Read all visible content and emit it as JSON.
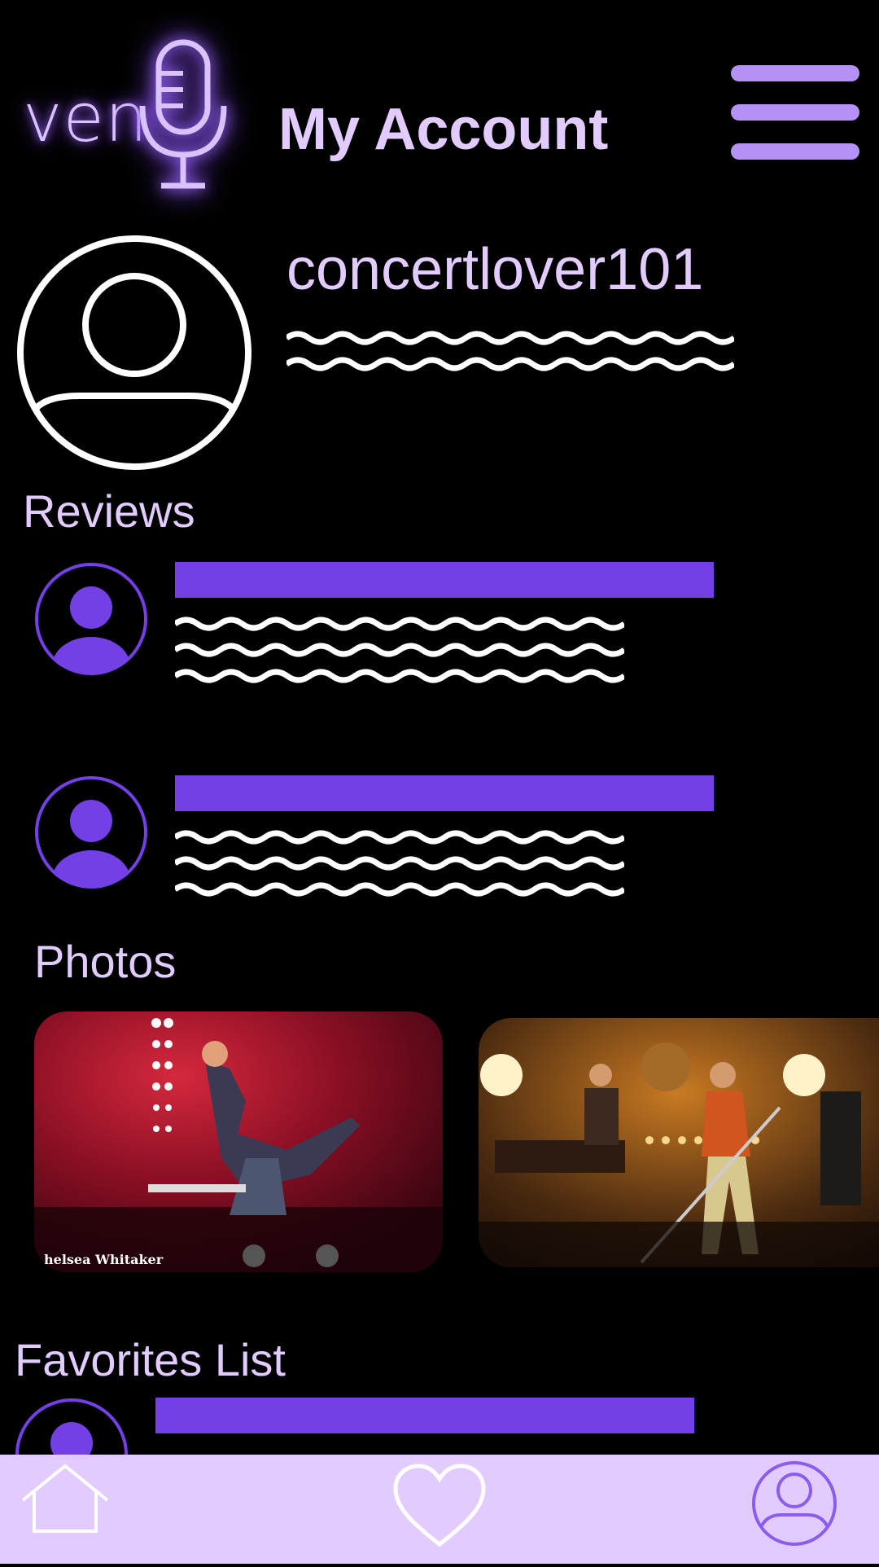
{
  "header": {
    "logo_text": "ven",
    "title": "My Account",
    "menu_icon": "hamburger-menu-icon"
  },
  "profile": {
    "username": "concertlover101",
    "avatar_icon": "user-avatar-icon"
  },
  "reviews": {
    "label": "Reviews",
    "items": [
      {
        "avatar_icon": "user-avatar-icon"
      },
      {
        "avatar_icon": "user-avatar-icon"
      }
    ]
  },
  "photos": {
    "label": "Photos",
    "items": [
      {
        "credit": "helsea Whitaker"
      },
      {
        "credit": ""
      }
    ]
  },
  "favorites": {
    "label": "Favorites List"
  },
  "bottom_nav": {
    "items": [
      "home-icon",
      "heart-icon",
      "profile-icon"
    ]
  },
  "colors": {
    "background": "#000000",
    "accent": "#7440e6",
    "lavender": "#e2ccff",
    "menu": "#b391f5"
  }
}
